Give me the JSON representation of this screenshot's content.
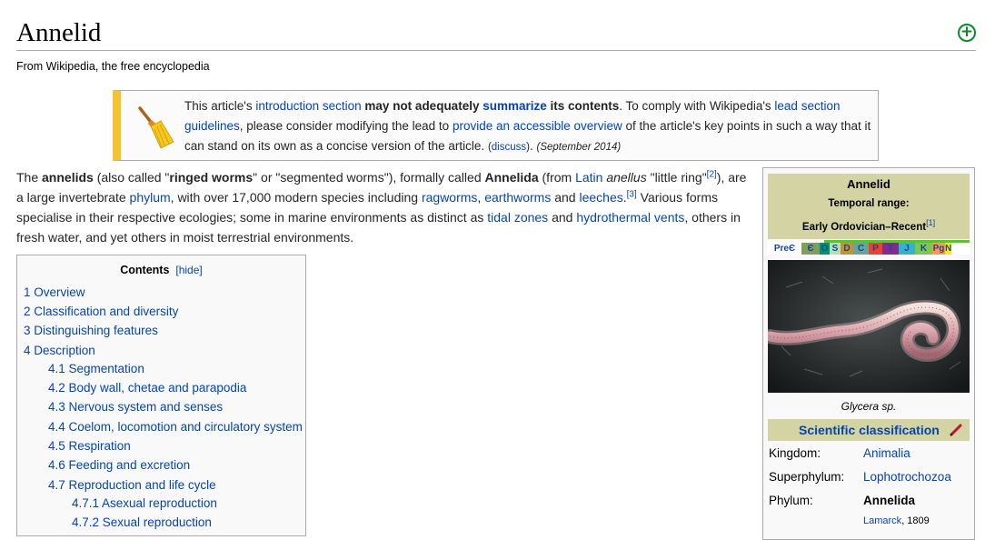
{
  "title": "Annelid",
  "site_sub": "From Wikipedia, the free encyclopedia",
  "ambox": {
    "t1": "This article's ",
    "l1": "introduction section",
    "b1": " may not adequately ",
    "l2": "summarize",
    "b2": " its contents",
    "t2": ". To comply with Wikipedia's ",
    "l3": "lead section guidelines",
    "t3": ", please consider modifying the lead to ",
    "l4": "provide an accessible overview",
    "t4": " of the article's key points in such a way that it can stand on its own as a concise version of the article. ",
    "discuss": "discuss",
    "date": "(September 2014)"
  },
  "lead": {
    "p1": "The ",
    "annelids": "annelids",
    "p2": " (also called \"",
    "ringed": "ringed worms",
    "p3": "\" or \"segmented worms\"), formally called ",
    "annelida": "Annelida",
    "p4": " (from ",
    "latin": "Latin",
    "anellus": "anellus",
    "p5": " \"little ring\"",
    "ref2": "[2]",
    "p6": "), are a large invertebrate ",
    "phylum": "phylum",
    "p7": ", with over 17,000 modern species including ",
    "ragworms": "ragworms",
    "comma": ", ",
    "earthworms": "earthworms",
    "and": " and ",
    "leeches": "leeches",
    "period": ".",
    "ref3": "[3]",
    "p8": " Various forms specialise in their respective ecologies; some in marine environments as distinct as ",
    "tidal": "tidal zones",
    "hydro": "hydrothermal vents",
    "p9": ", others in fresh water, and yet others in moist terrestrial environments."
  },
  "toc": {
    "title": "Contents",
    "hide": "hide",
    "items": [
      "1 Overview",
      "2 Classification and diversity",
      "3 Distinguishing features",
      "4 Description",
      "4.1 Segmentation",
      "4.2 Body wall, chetae and parapodia",
      "4.3 Nervous system and senses",
      "4.4 Coelom, locomotion and circulatory system",
      "4.5 Respiration",
      "4.6 Feeding and excretion",
      "4.7 Reproduction and life cycle",
      "4.7.1 Asexual reproduction",
      "4.7.2 Sexual reproduction"
    ]
  },
  "infobox": {
    "name": "Annelid",
    "temporal_label": "Temporal range:",
    "range": "Early Ordovician–Recent",
    "range_ref": "[1]",
    "periods": [
      {
        "label": "PreЄ",
        "color": "#ffffff"
      },
      {
        "label": "Є",
        "color": "#7fa056"
      },
      {
        "label": "O",
        "color": "#009270"
      },
      {
        "label": "S",
        "color": "#b3e1b6"
      },
      {
        "label": "D",
        "color": "#cb8c37"
      },
      {
        "label": "C",
        "color": "#67a599"
      },
      {
        "label": "P",
        "color": "#f04028"
      },
      {
        "label": "T",
        "color": "#812b92"
      },
      {
        "label": "J",
        "color": "#34b2c9"
      },
      {
        "label": "K",
        "color": "#7fc64e"
      },
      {
        "label": "Pg",
        "color": "#fd9a52"
      },
      {
        "label": "N",
        "color": "#ffe619"
      }
    ],
    "caption": "Glycera sp.",
    "sci_class": "Scientific classification",
    "rows": [
      {
        "label": "Kingdom:",
        "value": "Animalia"
      },
      {
        "label": "Superphylum:",
        "value": "Lophotrochozoa"
      },
      {
        "label": "Phylum:",
        "value": "Annelida"
      }
    ],
    "author": "Lamarck",
    "author_year": ", 1809"
  },
  "colors": {
    "link": "#0645ad",
    "ambox_border": "#f4c430",
    "taxobox_band": "#d3d3a4",
    "add_icon": "#0a8a2a"
  }
}
